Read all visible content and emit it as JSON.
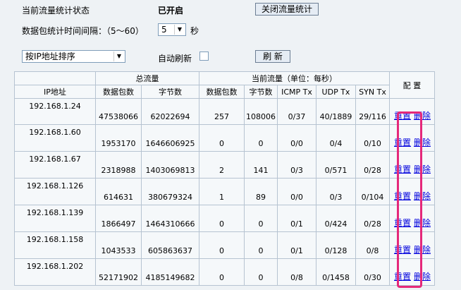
{
  "top": {
    "status_label": "当前流量统计状态",
    "status_value": "已开启",
    "close_stats_button": "关闭流量统计",
    "interval_label": "数据包统计时间间隔：（5～60）",
    "interval_value": "5",
    "interval_unit": "秒",
    "sort_value": "按IP地址排序",
    "auto_refresh_label": "自动刷新",
    "refresh_button": "刷 新"
  },
  "table": {
    "ip_header": "IP地址",
    "total_header": "总流量",
    "current_header": "当前流量（单位：每秒）",
    "config_header": "配 置",
    "sub_headers": [
      "数据包数",
      "字节数",
      "数据包数",
      "字节数",
      "ICMP Tx",
      "UDP Tx",
      "SYN Tx"
    ],
    "reset_label": "重置",
    "delete_label": "删除",
    "rows": [
      {
        "ip": "192.168.1.24",
        "cells": [
          "47538066",
          "62022694",
          "257",
          "108006",
          "0/37",
          "40/1889",
          "29/116"
        ]
      },
      {
        "ip": "192.168.1.60",
        "cells": [
          "1953170",
          "1646606925",
          "0",
          "0",
          "0/0",
          "0/4",
          "0/10"
        ]
      },
      {
        "ip": "192.168.1.67",
        "cells": [
          "2318988",
          "1403069813",
          "2",
          "141",
          "0/3",
          "0/571",
          "0/28"
        ]
      },
      {
        "ip": "192.168.1.126",
        "cells": [
          "614631",
          "380679324",
          "1",
          "89",
          "0/0",
          "0/3",
          "0/104"
        ]
      },
      {
        "ip": "192.168.1.139",
        "cells": [
          "1866497",
          "1464310666",
          "0",
          "0",
          "0/1",
          "0/424",
          "0/28"
        ]
      },
      {
        "ip": "192.168.1.158",
        "cells": [
          "1043533",
          "605863637",
          "0",
          "0",
          "0/1",
          "0/128",
          "0/8"
        ]
      },
      {
        "ip": "192.168.1.202",
        "cells": [
          "52171902",
          "4185149682",
          "0",
          "0",
          "0/8",
          "0/1458",
          "0/30"
        ]
      }
    ]
  },
  "colors": {
    "highlight": "#e5287a",
    "link": "#0000dd"
  }
}
